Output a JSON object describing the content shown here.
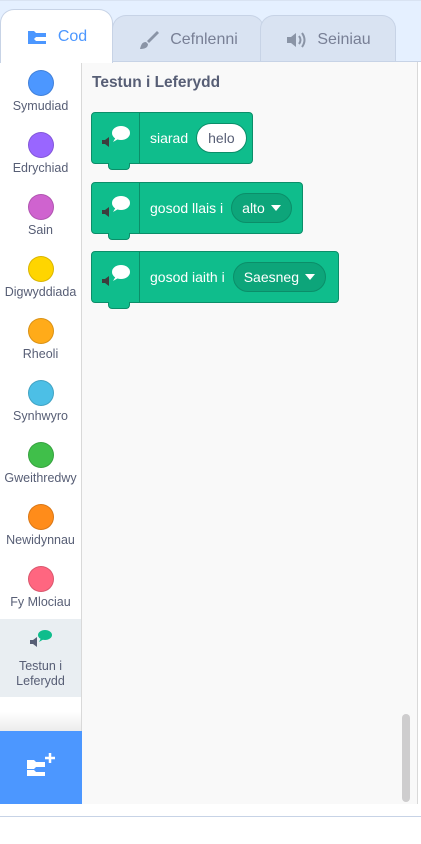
{
  "tabs": [
    {
      "label": "Cod",
      "icon": "code-icon",
      "active": true
    },
    {
      "label": "Cefnlenni",
      "icon": "paintbrush-icon",
      "active": false
    },
    {
      "label": "Seiniau",
      "icon": "speaker-icon",
      "active": false
    }
  ],
  "categories": [
    {
      "label": "Symudiad",
      "color": "#4c97ff"
    },
    {
      "label": "Edrychiad",
      "color": "#9966ff"
    },
    {
      "label": "Sain",
      "color": "#cf63cf"
    },
    {
      "label": "Digwyddiada",
      "color": "#ffd500"
    },
    {
      "label": "Rheoli",
      "color": "#ffab19"
    },
    {
      "label": "Synhwyro",
      "color": "#4cbfe6"
    },
    {
      "label": "Gweithredwy",
      "color": "#40bf4a"
    },
    {
      "label": "Newidynnau",
      "color": "#ff8c1a"
    },
    {
      "label": "Fy Mlociau",
      "color": "#ff6680"
    },
    {
      "label": "Testun i Leferydd",
      "icon": "text-to-speech-icon",
      "selected": true
    }
  ],
  "flyout": {
    "title": "Testun i Leferydd",
    "blocks": [
      {
        "text": "siarad",
        "input": "helo"
      },
      {
        "text": "gosod llais i",
        "dropdown": "alto"
      },
      {
        "text": "gosod iaith i",
        "dropdown": "Saesneg"
      }
    ]
  },
  "extension_button": {
    "icon": "add-extension-icon"
  },
  "colors": {
    "accent": "#4c97ff",
    "block": "#0fbd8c",
    "block_border": "#0b8e69"
  }
}
